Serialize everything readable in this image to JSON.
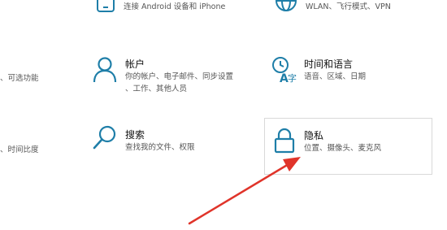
{
  "left_column": {
    "frag1": "功能",
    "frag2": "、可选功能",
    "frag3": "、时间比度"
  },
  "tiles": {
    "phone": {
      "desc": "连接 Android 设备和 iPhone",
      "icon": "phone-icon"
    },
    "network": {
      "desc": "WLAN、飞行模式、VPN",
      "icon": "globe-icon"
    },
    "accounts": {
      "title": "帐户",
      "desc1": "你的帐户、电子邮件、同步设置",
      "desc2": "、工作、其他人员",
      "icon": "person-icon"
    },
    "time_language": {
      "title": "时间和语言",
      "desc": "语音、区域、日期",
      "icon": "time-language-icon"
    },
    "search": {
      "title": "搜索",
      "desc": "查找我的文件、权限",
      "icon": "search-icon"
    },
    "privacy": {
      "title": "隐私",
      "desc": "位置、摄像头、麦克风",
      "icon": "lock-icon"
    }
  },
  "colors": {
    "icon": "#1e7ea8",
    "arrow": "#e0342a",
    "tile_border": "#d9d9d9"
  }
}
